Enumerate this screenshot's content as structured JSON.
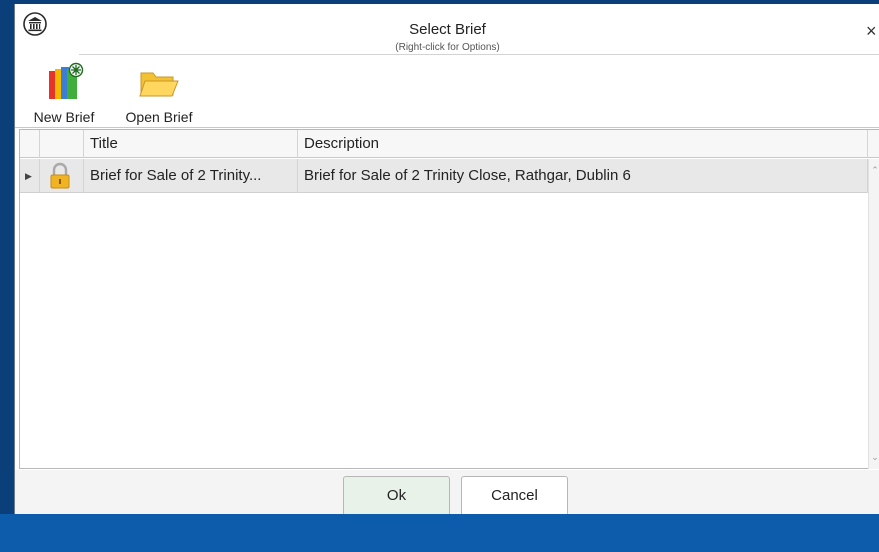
{
  "window": {
    "title": "Select Brief",
    "subtitle": "(Right-click for Options)",
    "close_glyph": "×",
    "app_icon": "courthouse-icon"
  },
  "ribbon": {
    "new_brief": {
      "label": "New Brief",
      "icon": "new-brief-icon"
    },
    "open_brief": {
      "label": "Open Brief",
      "icon": "folder-icon"
    }
  },
  "grid": {
    "columns": [
      "",
      "",
      "Title",
      "Description"
    ],
    "rows": [
      {
        "indicator": "▶",
        "lock_icon": "padlock-icon",
        "title": "Brief for Sale of 2 Trinity...",
        "description": "Brief for Sale of 2 Trinity Close, Rathgar, Dublin 6"
      }
    ]
  },
  "buttons": {
    "ok": "Ok",
    "cancel": "Cancel"
  },
  "colors": {
    "frame": "#0a3f7a",
    "bottom_bar": "#0d5cab",
    "selected_row": "#e8e8e8",
    "ok_button": "#e9f2e8"
  }
}
